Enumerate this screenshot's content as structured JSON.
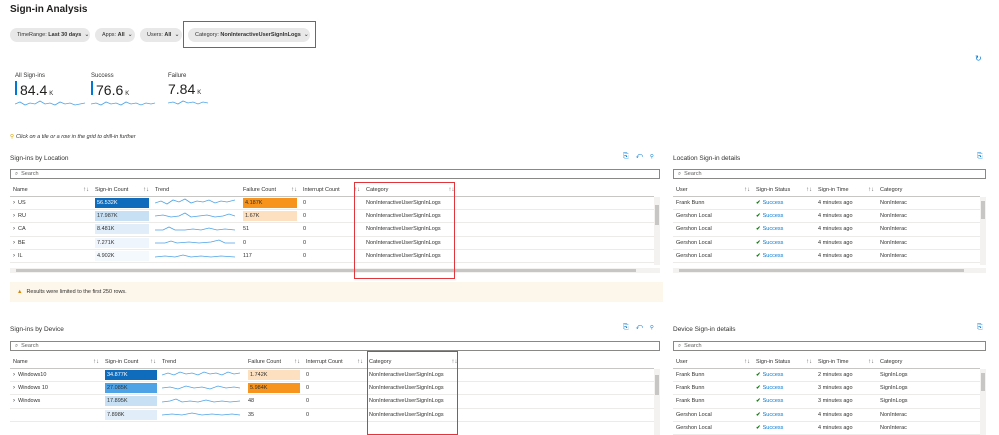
{
  "page": {
    "title": "Sign-in Analysis",
    "hint": "Click on a tile or a row in the grid to drill-in further",
    "refresh_icon": "refresh-icon"
  },
  "filters": [
    {
      "label": "TimeRange:",
      "value": "Last 30 days"
    },
    {
      "label": "Apps:",
      "value": "All"
    },
    {
      "label": "Users:",
      "value": "All"
    },
    {
      "label": "Category:",
      "value": "NonInteractiveUserSignInLogs"
    }
  ],
  "tiles": [
    {
      "label": "All Sign-ins",
      "value": "84.4",
      "unit": "K",
      "accent": "#0078d4"
    },
    {
      "label": "Success",
      "value": "76.6",
      "unit": "K",
      "accent": "#0078d4"
    },
    {
      "label": "Failure",
      "value": "7.84",
      "unit": "K",
      "accent": ""
    }
  ],
  "location": {
    "title": "Sign-ins by Location",
    "search_placeholder": "Search",
    "columns": [
      "Name",
      "Sign-in Count",
      "Trend",
      "Failure Count",
      "Interrupt Count",
      "Category"
    ],
    "rows": [
      {
        "name": "US",
        "count": "56.532K",
        "count_frac": 1.0,
        "fail": "4.187K",
        "fail_frac": 1.0,
        "interrupt": "0",
        "category": "NonInteractiveUserSignInLogs"
      },
      {
        "name": "RU",
        "count": "17.987K",
        "count_frac": 1.0,
        "fail": "1.67K",
        "fail_frac": 1.0,
        "interrupt": "0",
        "category": "NonInteractiveUserSignInLogs"
      },
      {
        "name": "CA",
        "count": "8.481K",
        "count_frac": 1.0,
        "fail": "51",
        "fail_frac": 0,
        "interrupt": "0",
        "category": "NonInteractiveUserSignInLogs"
      },
      {
        "name": "BE",
        "count": "7.271K",
        "count_frac": 1.0,
        "fail": "0",
        "fail_frac": 0,
        "interrupt": "0",
        "category": "NonInteractiveUserSignInLogs"
      },
      {
        "name": "IL",
        "count": "4.902K",
        "count_frac": 1.0,
        "fail": "117",
        "fail_frac": 0,
        "interrupt": "0",
        "category": "NonInteractiveUserSignInLogs"
      }
    ],
    "warning": "Results were limited to the first 250 rows."
  },
  "location_details": {
    "title": "Location Sign-in details",
    "search_placeholder": "Search",
    "columns": [
      "User",
      "Sign-in Status",
      "Sign-in Time",
      "Category"
    ],
    "rows": [
      {
        "user": "Frank Bunn",
        "status": "Success",
        "time": "4 minutes ago",
        "category": "NonInterac"
      },
      {
        "user": "Gershon Local",
        "status": "Success",
        "time": "4 minutes ago",
        "category": "NonInterac"
      },
      {
        "user": "Gershon Local",
        "status": "Success",
        "time": "4 minutes ago",
        "category": "NonInterac"
      },
      {
        "user": "Gershon Local",
        "status": "Success",
        "time": "4 minutes ago",
        "category": "NonInterac"
      },
      {
        "user": "Gershon Local",
        "status": "Success",
        "time": "4 minutes ago",
        "category": "NonInterac"
      }
    ]
  },
  "device": {
    "title": "Sign-ins by Device",
    "search_placeholder": "Search",
    "columns": [
      "Name",
      "Sign-in Count",
      "Trend",
      "Failure Count",
      "Interrupt Count",
      "Category"
    ],
    "rows": [
      {
        "name": "Windows10",
        "count": "34.877K",
        "fail": "1.742K",
        "interrupt": "0",
        "category": "NonInteractiveUserSignInLogs"
      },
      {
        "name": "Windows 10",
        "count": "27.085K",
        "fail": "5.984K",
        "interrupt": "0",
        "category": "NonInteractiveUserSignInLogs"
      },
      {
        "name": "Windows",
        "count": "17.895K",
        "fail": "48",
        "interrupt": "0",
        "category": "NonInteractiveUserSignInLogs"
      },
      {
        "name": "",
        "count": "7.898K",
        "fail": "35",
        "interrupt": "0",
        "category": "NonInteractiveUserSignInLogs"
      }
    ]
  },
  "device_details": {
    "title": "Device Sign-in details",
    "search_placeholder": "Search",
    "columns": [
      "User",
      "Sign-in Status",
      "Sign-in Time",
      "Category"
    ],
    "rows": [
      {
        "user": "Frank Bunn",
        "status": "Success",
        "time": "2 minutes ago",
        "category": "SignInLogs"
      },
      {
        "user": "Frank Bunn",
        "status": "Success",
        "time": "3 minutes ago",
        "category": "SignInLogs"
      },
      {
        "user": "Frank Bunn",
        "status": "Success",
        "time": "3 minutes ago",
        "category": "SignInLogs"
      },
      {
        "user": "Gershon Local",
        "status": "Success",
        "time": "4 minutes ago",
        "category": "NonInterac"
      },
      {
        "user": "Gershon Local",
        "status": "Success",
        "time": "4 minutes ago",
        "category": "NonInterac"
      }
    ]
  },
  "colors": {
    "count_dark": "#0f6cbd",
    "count_mid": "#4ea3e6",
    "count_light": "#c7e0f4",
    "fail_dark": "#f7941d",
    "fail_light": "#fde0bf",
    "highlight": "#e0353b"
  }
}
